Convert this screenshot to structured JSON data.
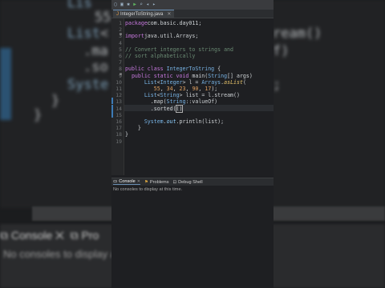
{
  "editor": {
    "tab_title": "IntegerToString.java",
    "lines": [
      {
        "n": "1",
        "code": [
          [
            "kw",
            "package"
          ],
          [
            "",
            "com.basic.day011;"
          ]
        ]
      },
      {
        "n": "2",
        "code": []
      },
      {
        "n": "3",
        "code": [
          [
            "kw",
            "import"
          ],
          [
            "",
            "java.util.Arrays;"
          ]
        ]
      },
      {
        "n": "4",
        "code": []
      },
      {
        "n": "5",
        "code": [
          [
            "cm",
            "// Convert integers to strings and"
          ]
        ]
      },
      {
        "n": "6",
        "code": [
          [
            "cm",
            "// sort alphabetically"
          ]
        ]
      },
      {
        "n": "7",
        "code": []
      },
      {
        "n": "8",
        "code": [
          [
            "kw",
            "public class "
          ],
          [
            "ty",
            "IntegerToString"
          ],
          [
            "",
            " {"
          ]
        ]
      },
      {
        "n": "9",
        "code": [
          [
            "kw",
            "  public static void "
          ],
          [
            "",
            "main("
          ],
          [
            "ty",
            "String"
          ],
          [
            "",
            "[] args)"
          ]
        ]
      },
      {
        "n": "10",
        "code": [
          [
            "",
            "      "
          ],
          [
            "ty",
            "List"
          ],
          [
            "",
            "<"
          ],
          [
            "ty",
            "Integer"
          ],
          [
            "",
            "> l = "
          ],
          [
            "ty",
            "Arrays"
          ],
          [
            "",
            "."
          ],
          [
            "fn",
            "asList"
          ],
          [
            "",
            "("
          ]
        ]
      },
      {
        "n": "11",
        "code": [
          [
            "",
            "         "
          ],
          [
            "num",
            "55"
          ],
          [
            ", "
          ],
          [
            "num",
            "34"
          ],
          [
            ", "
          ],
          [
            "num",
            "23"
          ],
          [
            ", "
          ],
          [
            "num",
            "90"
          ],
          [
            ", "
          ],
          [
            "num",
            "17"
          ],
          [
            "",
            ");"
          ]
        ]
      },
      {
        "n": "12",
        "code": [
          [
            "",
            "      "
          ],
          [
            "ty",
            "List"
          ],
          [
            "",
            "<"
          ],
          [
            "ty",
            "String"
          ],
          [
            "",
            "> list = l.stream()"
          ]
        ]
      },
      {
        "n": "13",
        "code": [
          [
            "",
            "        .map("
          ],
          [
            "ty",
            "String"
          ],
          [
            "",
            "::valueOf)"
          ]
        ]
      },
      {
        "n": "14",
        "code": [
          [
            "",
            "        .sorted("
          ],
          [
            "",
            "()"
          ]
        ]
      },
      {
        "n": "15",
        "code": []
      },
      {
        "n": "16",
        "code": [
          [
            "",
            "      "
          ],
          [
            "ty",
            "System"
          ],
          [
            "",
            "."
          ],
          [
            "fld",
            "out"
          ],
          [
            "",
            ".println(list);"
          ]
        ]
      },
      {
        "n": "17",
        "code": [
          [
            "",
            "    }"
          ]
        ]
      },
      {
        "n": "18",
        "code": [
          [
            "",
            "}"
          ]
        ]
      },
      {
        "n": "19",
        "code": []
      }
    ]
  },
  "console": {
    "tabs": [
      {
        "label": "Console",
        "icon": "console-icon",
        "active": true
      },
      {
        "label": "Problems",
        "icon": "problems-icon",
        "active": false
      },
      {
        "label": "Debug Shell",
        "icon": "debug-shell-icon",
        "active": false
      }
    ],
    "message": "No consoles to display at this time."
  },
  "background": {
    "console_tab_1": "Console",
    "console_tab_2": "Pro",
    "console_msg": "No consoles to display a"
  },
  "colors": {
    "keyword": "#c678dd",
    "type": "#78b4e6",
    "comment": "#6a8a73",
    "number": "#e0a060",
    "editor_bg": "#1e1f22"
  }
}
